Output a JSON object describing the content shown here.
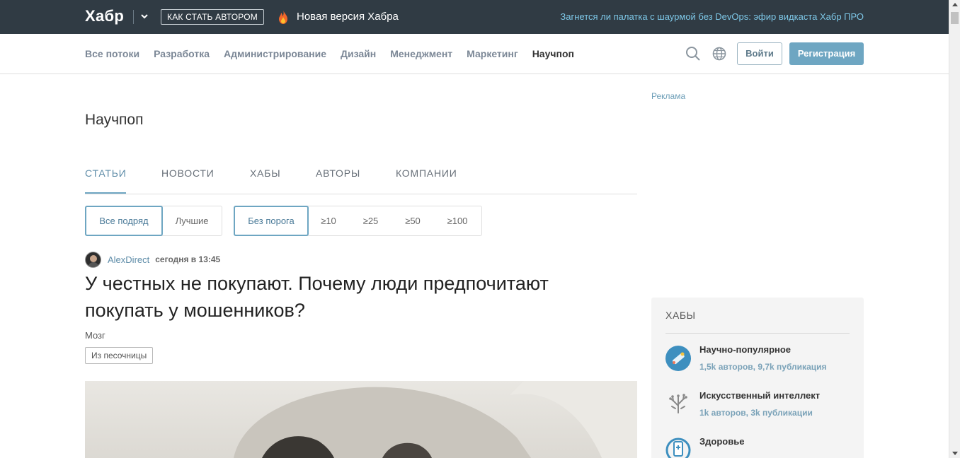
{
  "topbar": {
    "logo": "Хабр",
    "author_button": "КАК СТАТЬ АВТОРОМ",
    "new_version": "Новая версия Хабра",
    "promo": "Загнется ли палатка с шаурмой без DevOps: эфир видкаста Хабр ПРО"
  },
  "nav": {
    "items": [
      {
        "label": "Все потоки",
        "active": false
      },
      {
        "label": "Разработка",
        "active": false
      },
      {
        "label": "Администрирование",
        "active": false
      },
      {
        "label": "Дизайн",
        "active": false
      },
      {
        "label": "Менеджмент",
        "active": false
      },
      {
        "label": "Маркетинг",
        "active": false
      },
      {
        "label": "Научпоп",
        "active": true
      }
    ],
    "login": "Войти",
    "register": "Регистрация"
  },
  "page": {
    "title": "Научпоп",
    "tabs": [
      "СТАТЬИ",
      "НОВОСТИ",
      "ХАБЫ",
      "АВТОРЫ",
      "КОМПАНИИ"
    ],
    "active_tab": "СТАТЬИ",
    "filters_sort": [
      "Все подряд",
      "Лучшие"
    ],
    "filters_threshold": [
      "Без порога",
      "≥10",
      "≥25",
      "≥50",
      "≥100"
    ]
  },
  "post": {
    "author": "AlexDirect",
    "time": "сегодня в 13:45",
    "title": "У честных не покупают. Почему люди предпочитают покупать у мошенников?",
    "hub": "Мозг",
    "badge": "Из песочницы"
  },
  "sidebar": {
    "ad_label": "Реклама",
    "hubs_title": "ХАБЫ",
    "hubs": [
      {
        "name": "Научно-популярное",
        "stats": "1,5k авторов, 9,7k публикация"
      },
      {
        "name": "Искусственный интеллект",
        "stats": "1k авторов, 3k публикации"
      },
      {
        "name": "Здоровье",
        "stats": ""
      }
    ]
  },
  "colors": {
    "topbar_bg": "#303b44",
    "accent": "#6ea6c2",
    "link": "#5e8ca8",
    "promo": "#7ec8e8"
  },
  "icons": [
    "chevron-down-icon",
    "fire-icon",
    "search-icon",
    "globe-icon",
    "avatar",
    "hub-science-icon",
    "hub-ai-icon",
    "hub-health-icon"
  ]
}
